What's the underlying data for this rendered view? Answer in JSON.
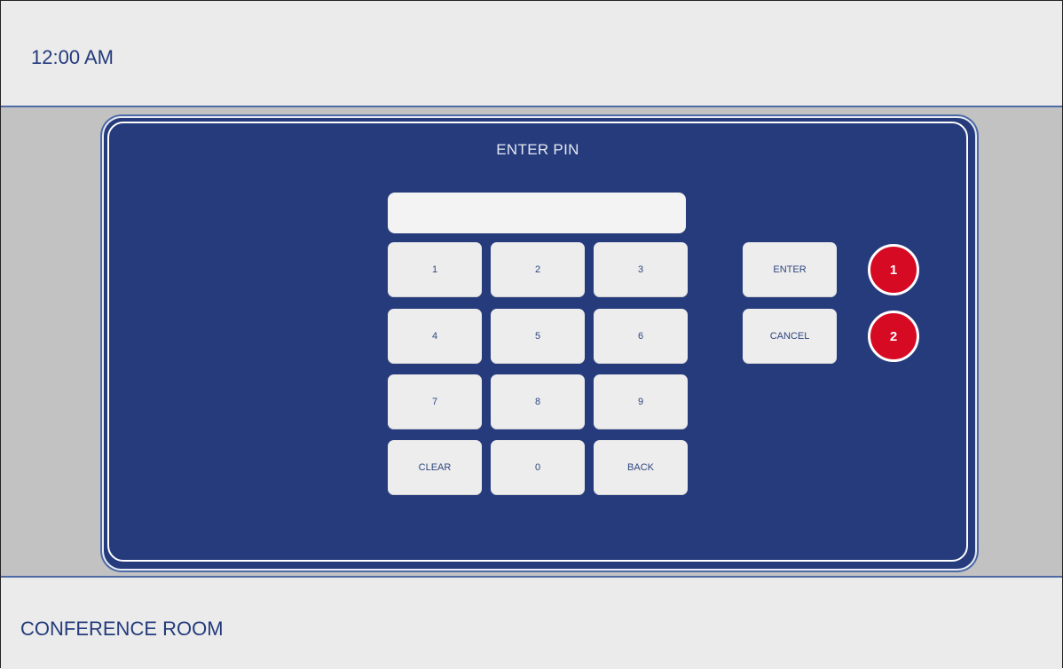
{
  "header": {
    "time": "12:00 AM"
  },
  "panel": {
    "title": "ENTER PIN",
    "pin_value": "",
    "keypad": {
      "k1": "1",
      "k2": "2",
      "k3": "3",
      "k4": "4",
      "k5": "5",
      "k6": "6",
      "k7": "7",
      "k8": "8",
      "k9": "9",
      "clear": "CLEAR",
      "k0": "0",
      "back": "BACK"
    },
    "actions": {
      "enter": "ENTER",
      "cancel": "CANCEL"
    },
    "callouts": {
      "c1": "1",
      "c2": "2"
    }
  },
  "footer": {
    "room": "CONFERENCE ROOM"
  },
  "colors": {
    "panel_blue": "#253b7c",
    "text_blue": "#233b7c",
    "callout_red": "#d70a24"
  }
}
